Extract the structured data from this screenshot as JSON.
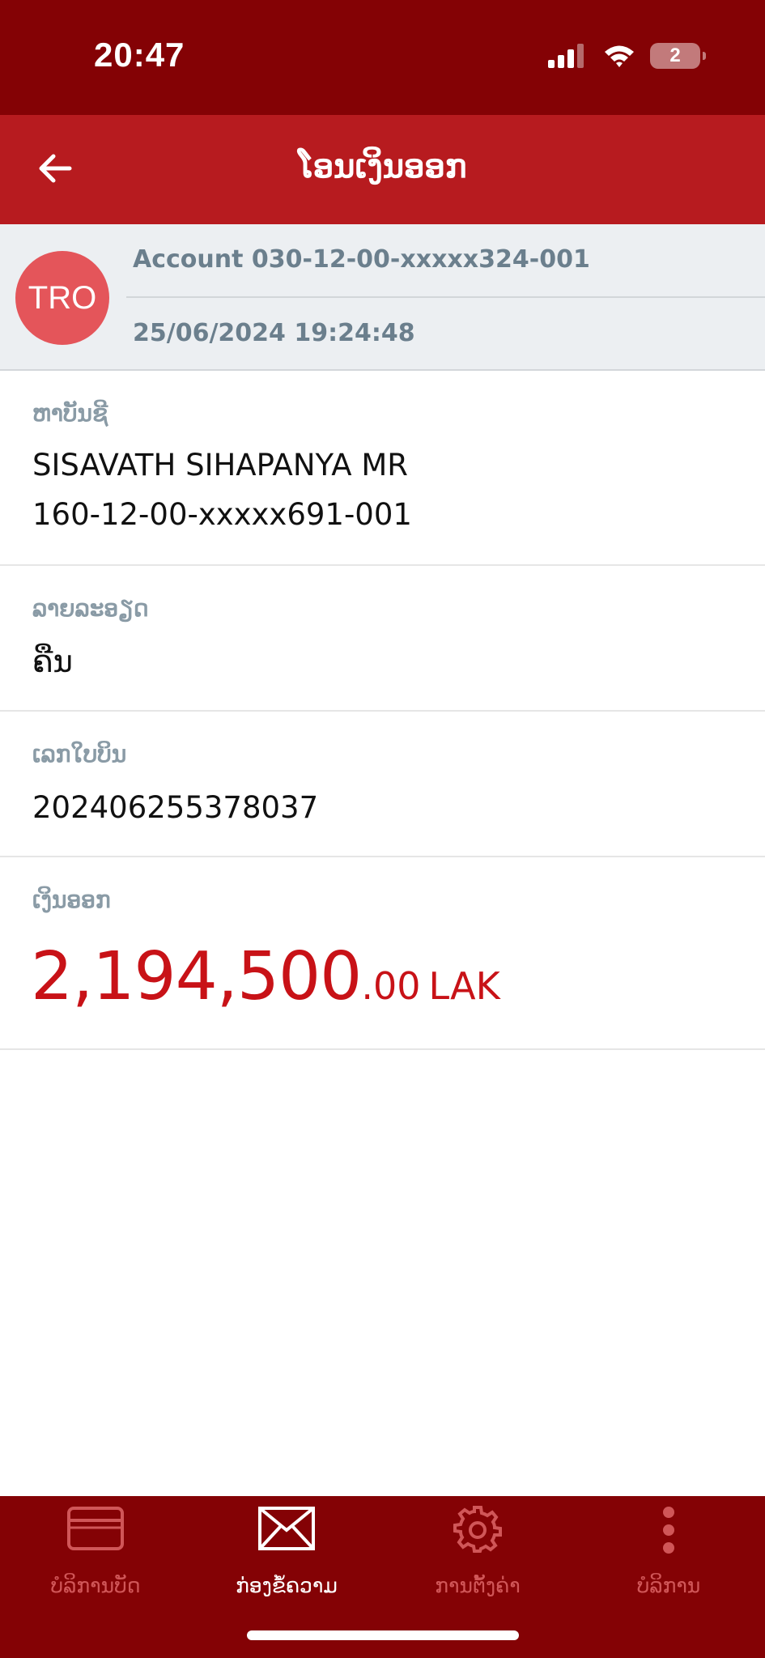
{
  "status": {
    "time": "20:47",
    "battery": "2"
  },
  "nav": {
    "title": "ໂອນເງິນອອກ",
    "back_icon": "arrow-left-icon"
  },
  "account": {
    "avatar_initials": "TRO",
    "account_line": "Account 030-12-00-xxxxx324-001",
    "datetime": "25/06/2024 19:24:48"
  },
  "details": {
    "to_account_label": "ຫາບັນຊີ",
    "to_account_name": "SISAVATH SIHAPANYA MR",
    "to_account_number": "160-12-00-xxxxx691-001",
    "description_label": "ລາຍລະອຽດ",
    "description_value": "ຄືນ",
    "bill_number_label": "ເລກໃບບິນ",
    "bill_number_value": "202406255378037",
    "amount_label": "ເງິນອອກ",
    "amount_main": "2,194,500",
    "amount_decimal": ".00",
    "amount_currency": "LAK"
  },
  "colors": {
    "status_bar": "#840205",
    "nav_bar": "#b71b1f",
    "accent": "#c81217",
    "avatar": "#e4555a"
  },
  "tabs": [
    {
      "label": "ບໍລິການບັດ",
      "icon": "card-icon",
      "active": false
    },
    {
      "label": "ກ່ອງຂໍ້ຄວາມ",
      "icon": "mail-icon",
      "active": true
    },
    {
      "label": "ການຕັ້ງຄ່າ",
      "icon": "gear-icon",
      "active": false
    },
    {
      "label": "ບໍລິການ",
      "icon": "more-vertical-icon",
      "active": false
    }
  ]
}
